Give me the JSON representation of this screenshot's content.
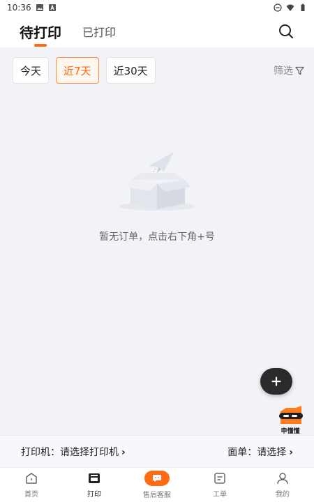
{
  "status_bar": {
    "time": "10:36",
    "icons": [
      "image-icon",
      "a-icon",
      "dnd-icon",
      "wifi-icon",
      "battery-icon"
    ]
  },
  "header": {
    "tabs": [
      {
        "label": "待打印",
        "active": true
      },
      {
        "label": "已打印",
        "active": false
      }
    ],
    "search_icon": "search-icon"
  },
  "filters": {
    "chips": [
      {
        "label": "今天",
        "active": false
      },
      {
        "label": "近7天",
        "active": true
      },
      {
        "label": "近30天",
        "active": false
      }
    ],
    "filter_label": "筛选",
    "filter_icon": "funnel-icon"
  },
  "empty_state": {
    "illustration": "empty-box-paper-plane",
    "message": "暂无订单，点击右下角+号"
  },
  "fab": {
    "icon": "plus-icon",
    "symbol": "+"
  },
  "mascot": {
    "label": "申懂懂"
  },
  "printer_bar": {
    "printer_label": "打印机：请选择打印机",
    "waybill_label": "面单：请选择",
    "chevron": "›"
  },
  "bottom_nav": [
    {
      "label": "首页",
      "icon": "home-icon",
      "active": false
    },
    {
      "label": "打印",
      "icon": "printer-icon",
      "active": true
    },
    {
      "label": "售后客服",
      "icon": "chat-icon",
      "active": false
    },
    {
      "label": "工单",
      "icon": "ticket-icon",
      "active": false
    },
    {
      "label": "我的",
      "icon": "person-icon",
      "active": false
    }
  ],
  "colors": {
    "accent": "#ff6a13",
    "background": "#f2f3f7",
    "fab": "#2b2b2b"
  }
}
